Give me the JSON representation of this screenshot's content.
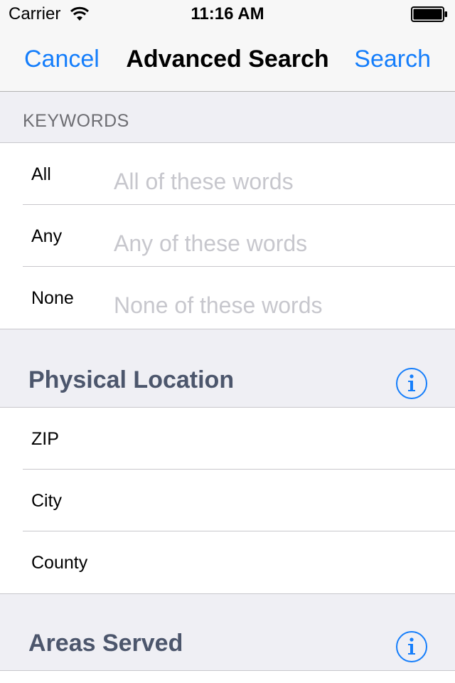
{
  "status_bar": {
    "carrier": "Carrier",
    "time": "11:16 AM"
  },
  "nav": {
    "cancel_label": "Cancel",
    "title": "Advanced Search",
    "search_label": "Search"
  },
  "keywords": {
    "header": "KEYWORDS",
    "rows": [
      {
        "label": "All",
        "placeholder": "All of these words"
      },
      {
        "label": "Any",
        "placeholder": "Any of these words"
      },
      {
        "label": "None",
        "placeholder": "None of these words"
      }
    ]
  },
  "physical_location": {
    "header": "Physical Location",
    "rows": [
      {
        "label": "ZIP"
      },
      {
        "label": "City"
      },
      {
        "label": "County"
      }
    ]
  },
  "areas_served": {
    "header": "Areas Served"
  },
  "colors": {
    "accent": "#157efb",
    "section_title": "#4c566c",
    "background": "#efeff4"
  },
  "icons": {
    "wifi": "wifi-icon",
    "battery": "battery-icon",
    "info": "info-icon"
  }
}
